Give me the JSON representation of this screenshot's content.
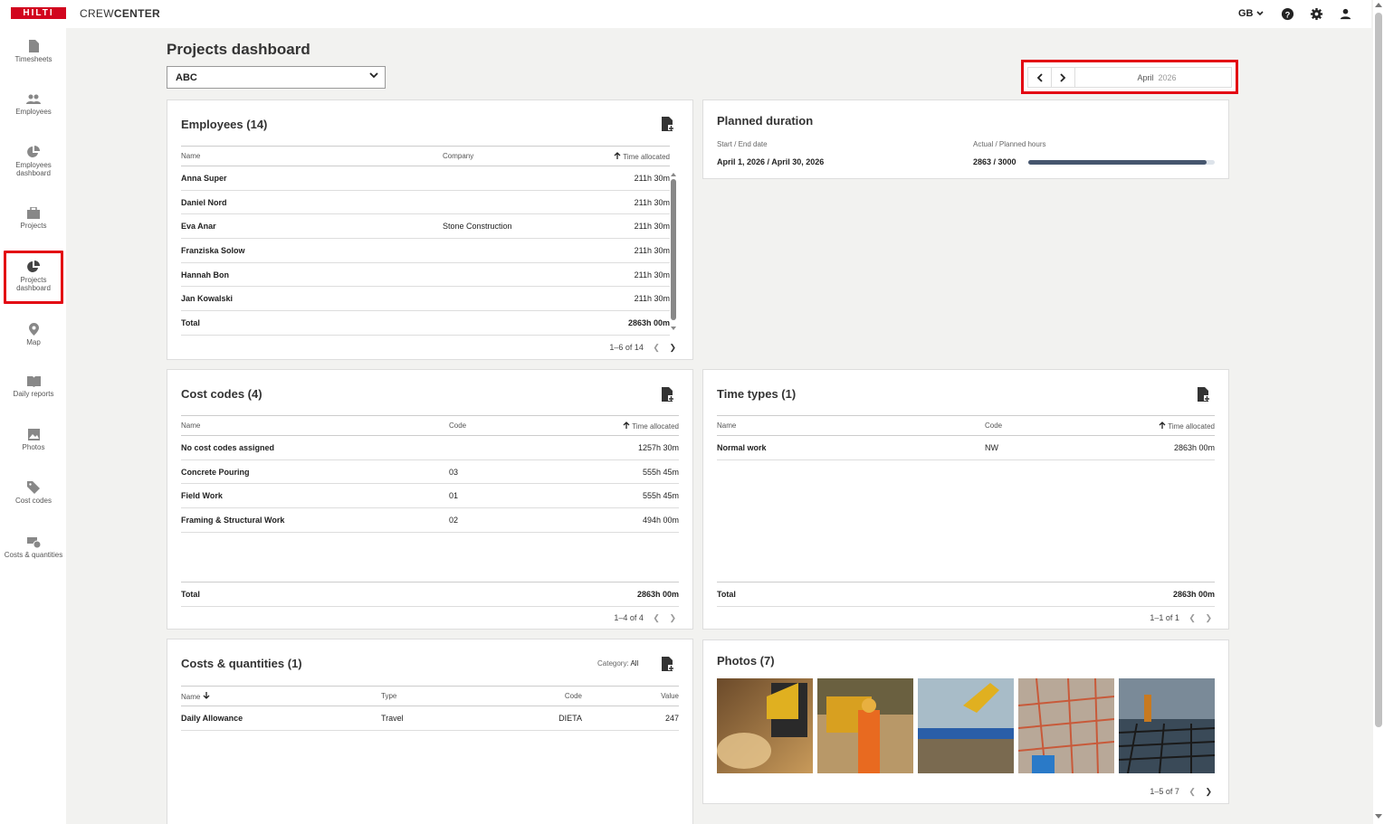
{
  "app": {
    "logo": "HILTI",
    "name_light": "CREW",
    "name_bold": "CENTER",
    "lang": "GB"
  },
  "nav": [
    {
      "label": "Timesheets",
      "icon": "document-icon"
    },
    {
      "label": "Employees",
      "icon": "people-icon"
    },
    {
      "label": "Employees dashboard",
      "icon": "pie-chart-icon"
    },
    {
      "label": "Projects",
      "icon": "briefcase-icon"
    },
    {
      "label": "Projects dashboard",
      "icon": "pie-chart-icon",
      "active": true
    },
    {
      "label": "Map",
      "icon": "map-pin-icon"
    },
    {
      "label": "Daily reports",
      "icon": "book-icon"
    },
    {
      "label": "Photos",
      "icon": "image-icon"
    },
    {
      "label": "Cost codes",
      "icon": "tag-icon"
    },
    {
      "label": "Costs & quantities",
      "icon": "coins-icon"
    }
  ],
  "page": {
    "title": "Projects dashboard",
    "project": "ABC",
    "month": "April",
    "year": "2026"
  },
  "employees": {
    "title": "Employees (14)",
    "headers": [
      "Name",
      "Company",
      "Time allocated"
    ],
    "rows": [
      {
        "name": "Anna Super",
        "company": "",
        "time": "211h 30m"
      },
      {
        "name": "Daniel Nord",
        "company": "",
        "time": "211h 30m"
      },
      {
        "name": "Eva Anar",
        "company": "Stone Construction",
        "time": "211h 30m"
      },
      {
        "name": "Franziska Solow",
        "company": "",
        "time": "211h 30m"
      },
      {
        "name": "Hannah Bon",
        "company": "",
        "time": "211h 30m"
      },
      {
        "name": "Jan Kowalski",
        "company": "",
        "time": "211h 30m"
      }
    ],
    "total_label": "Total",
    "total": "2863h 00m",
    "pager": "1–6 of 14"
  },
  "planned": {
    "title": "Planned duration",
    "dates_label": "Start / End date",
    "dates": "April 1, 2026 / April 30, 2026",
    "hours_label": "Actual / Planned hours",
    "hours": "2863 / 3000",
    "progress": 0.954
  },
  "costcodes": {
    "title": "Cost codes (4)",
    "headers": [
      "Name",
      "Code",
      "Time allocated"
    ],
    "rows": [
      {
        "name": "No cost codes assigned",
        "code": "",
        "time": "1257h 30m"
      },
      {
        "name": "Concrete Pouring",
        "code": "03",
        "time": "555h 45m"
      },
      {
        "name": "Field Work",
        "code": "01",
        "time": "555h 45m"
      },
      {
        "name": "Framing & Structural Work",
        "code": "02",
        "time": "494h 00m"
      }
    ],
    "total_label": "Total",
    "total": "2863h 00m",
    "pager": "1–4 of 4"
  },
  "timetypes": {
    "title": "Time types (1)",
    "headers": [
      "Name",
      "Code",
      "Time allocated"
    ],
    "rows": [
      {
        "name": "Normal work",
        "code": "NW",
        "time": "2863h 00m"
      }
    ],
    "total_label": "Total",
    "total": "2863h 00m",
    "pager": "1–1 of 1"
  },
  "costsq": {
    "title": "Costs & quantities (1)",
    "category_label": "Category:",
    "category": "All",
    "headers": [
      "Name",
      "Type",
      "Code",
      "Value"
    ],
    "rows": [
      {
        "name": "Daily Allowance",
        "type": "Travel",
        "code": "DIETA",
        "value": "247"
      }
    ]
  },
  "photos": {
    "title": "Photos (7)",
    "pager": "1–5 of 7",
    "count_shown": 5
  },
  "colors": {
    "brand": "#d2051e",
    "highlight": "#e30613",
    "progress": "#46566e"
  }
}
